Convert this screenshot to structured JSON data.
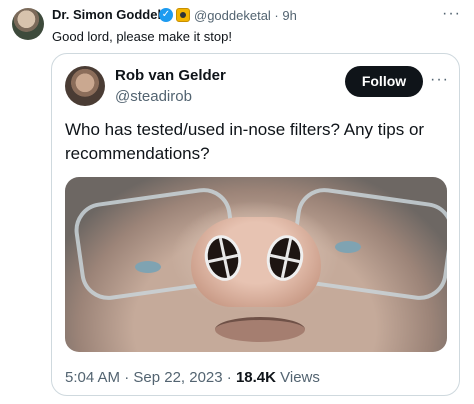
{
  "outer_tweet": {
    "author_name": "Dr. Simon Goddek",
    "verified_icon": "verified-check-icon",
    "org_badge_icon": "organization-badge-icon",
    "handle_time": "@goddeketal · 9h",
    "text": "Good lord, please make it stop!",
    "more_label": "···"
  },
  "quoted_tweet": {
    "author_name": "Rob van Gelder",
    "handle": "@steadirob",
    "follow_label": "Follow",
    "more_label": "···",
    "text": "Who has tested/used in-nose filters?  Any tips or recommendations?",
    "photo_subject": "close-up face wearing nose filters",
    "time": "5:04 AM · Sep 22, 2023 · ",
    "views_count": "18.4K",
    "views_label": " Views"
  },
  "colors": {
    "verified_blue": "#1d9bf0",
    "org_gold": "#f3b400",
    "secondary_text": "#536471",
    "follow_button": "#0f1419"
  }
}
